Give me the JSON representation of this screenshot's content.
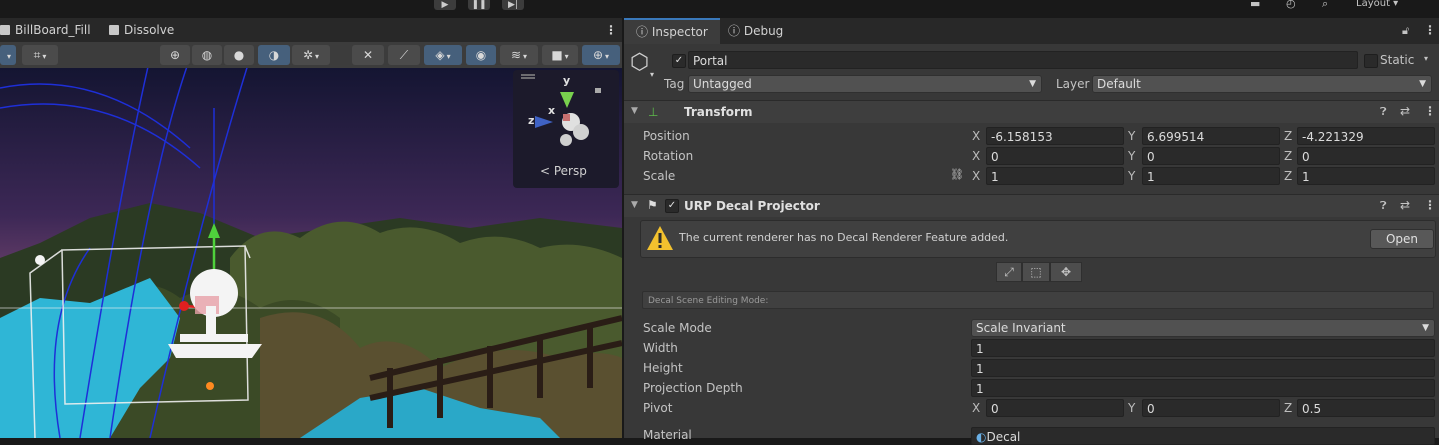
{
  "scene": {
    "tabs": [
      {
        "label": "BillBoard_Fill"
      },
      {
        "label": "Dissolve"
      }
    ],
    "persp_label": "< Persp",
    "gizmo_axes": {
      "y": "y",
      "x": "x",
      "z": "z"
    }
  },
  "inspector": {
    "tabs": [
      {
        "label": "Inspector"
      },
      {
        "label": "Debug"
      }
    ],
    "object": {
      "name": "Portal",
      "active": true,
      "static_label": "Static",
      "tag_label": "Tag",
      "tag_value": "Untagged",
      "layer_label": "Layer",
      "layer_value": "Default"
    },
    "transform": {
      "title": "Transform",
      "position_label": "Position",
      "rotation_label": "Rotation",
      "scale_label": "Scale",
      "position": {
        "x": "-6.158153",
        "y": "6.699514",
        "z": "-4.221329"
      },
      "rotation": {
        "x": "0",
        "y": "0",
        "z": "0"
      },
      "scale": {
        "x": "1",
        "y": "1",
        "z": "1"
      }
    },
    "decal": {
      "title": "URP Decal Projector",
      "enabled": true,
      "warning": "The current renderer has no Decal Renderer Feature added.",
      "open_button": "Open",
      "editing_mode_label": "Decal Scene Editing Mode:",
      "scale_mode_label": "Scale Mode",
      "scale_mode_value": "Scale Invariant",
      "width_label": "Width",
      "width_value": "1",
      "height_label": "Height",
      "height_value": "1",
      "depth_label": "Projection Depth",
      "depth_value": "1",
      "pivot_label": "Pivot",
      "pivot": {
        "x": "0",
        "y": "0",
        "z": "0.5"
      },
      "material_label": "Material",
      "material_value": "Decal"
    },
    "axis_labels": {
      "x": "X",
      "y": "Y",
      "z": "Z"
    }
  },
  "colors": {
    "accent": "#3a79bb",
    "warning": "#f2c12e",
    "panel": "#383838"
  }
}
